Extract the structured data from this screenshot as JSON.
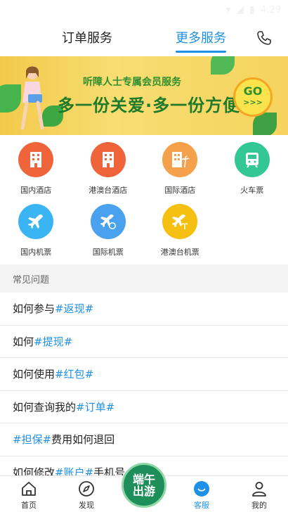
{
  "status_bar": {
    "time": "4:29"
  },
  "header": {
    "tabs": [
      {
        "label": "订单服务",
        "active": false
      },
      {
        "label": "更多服务",
        "active": true
      }
    ],
    "accent_color": "#1e90e6"
  },
  "banner": {
    "subtitle": "听障人士专属会员服务",
    "headline": "多一份关爱·多一份方便",
    "go_label": "GO",
    "go_arrows": ">>>"
  },
  "services": [
    {
      "label": "国内酒店",
      "icon": "hotel-icon",
      "color": "#f0643c"
    },
    {
      "label": "港澳台酒店",
      "icon": "hotel-icon",
      "color": "#f0643c"
    },
    {
      "label": "国际酒店",
      "icon": "hotel-palm-icon",
      "color": "#f5a04a"
    },
    {
      "label": "火车票",
      "icon": "train-icon",
      "color": "#34c796"
    },
    {
      "label": "国内机票",
      "icon": "plane-icon",
      "color": "#3ab4f2"
    },
    {
      "label": "国际机票",
      "icon": "plane-globe-icon",
      "color": "#4aa2ee"
    },
    {
      "label": "港澳台机票",
      "icon": "plane-palm-icon",
      "color": "#f5c012"
    }
  ],
  "faq": {
    "title": "常见问题",
    "items": [
      {
        "prefix": "如何参与",
        "tag": "#返现#",
        "suffix": ""
      },
      {
        "prefix": "如何",
        "tag": "#提现#",
        "suffix": ""
      },
      {
        "prefix": "如何使用",
        "tag": "#红包#",
        "suffix": ""
      },
      {
        "prefix": "如何查询我的",
        "tag": "#订单#",
        "suffix": ""
      },
      {
        "prefix": "",
        "tag": "#担保#",
        "suffix": "费用如何退回"
      },
      {
        "prefix": "如何修改",
        "tag": "#账户#",
        "suffix": "手机号"
      }
    ]
  },
  "bottom_nav": [
    {
      "label": "首页",
      "icon": "home-icon",
      "active": false
    },
    {
      "label": "发现",
      "icon": "compass-icon",
      "active": false
    },
    {
      "label": "客服",
      "icon": "customer-service-icon",
      "active": true
    },
    {
      "label": "我的",
      "icon": "user-icon",
      "active": false
    }
  ],
  "promo_badge": {
    "line1": "端午",
    "line2": "出游"
  }
}
